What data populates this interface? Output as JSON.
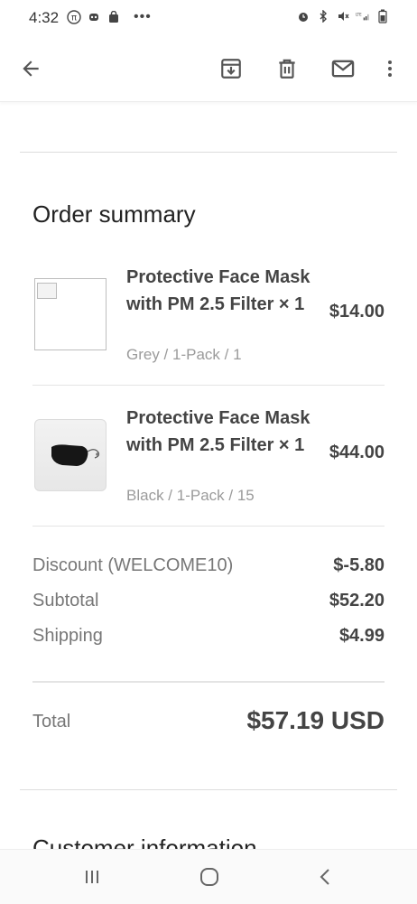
{
  "status_bar": {
    "time": "4:32",
    "left_icons": [
      "pi-icon",
      "robot-icon",
      "bag-icon"
    ],
    "more_indicator": "•••",
    "right_icons": [
      "alarm-icon",
      "bluetooth-icon",
      "mute-icon",
      "lte-signal-icon",
      "battery-icon"
    ]
  },
  "toolbar": {
    "icons": [
      "back-arrow-icon",
      "archive-icon",
      "delete-icon",
      "mail-icon",
      "more-vertical-icon"
    ]
  },
  "order": {
    "title": "Order summary",
    "items": [
      {
        "name": "Protective Face Mask with PM 2.5 Filter × 1",
        "variant": "Grey / 1-Pack / 1",
        "price": "$14.00",
        "image": "broken-image"
      },
      {
        "name": "Protective Face Mask with PM 2.5 Filter × 1",
        "variant": "Black / 1-Pack / 15",
        "price": "$44.00",
        "image": "black-face-mask"
      }
    ],
    "discount_label": "Discount (WELCOME10)",
    "discount_value": "$-5.80",
    "subtotal_label": "Subtotal",
    "subtotal_value": "$52.20",
    "shipping_label": "Shipping",
    "shipping_value": "$4.99",
    "total_label": "Total",
    "total_value": "$57.19 USD"
  },
  "next_section": {
    "title": "Customer information"
  },
  "navbar": {
    "icons": [
      "recent-apps-icon",
      "home-icon",
      "back-icon"
    ]
  },
  "colors": {
    "text": "#222222",
    "muted": "#777777",
    "variant": "#9b9b9b",
    "divider": "#e4e4e4"
  }
}
